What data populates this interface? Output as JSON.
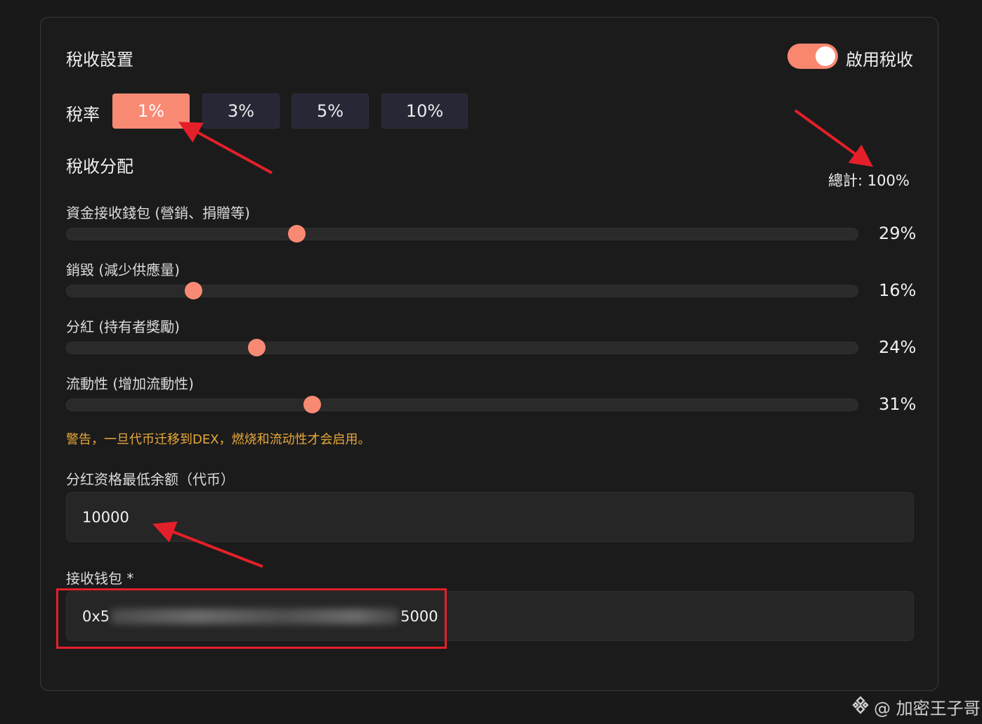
{
  "tax_settings": {
    "title": "稅收設置",
    "toggle_label": "啟用稅收",
    "toggle_on": true,
    "rate_label": "稅率",
    "rates": [
      "1%",
      "3%",
      "5%",
      "10%"
    ],
    "selected_rate": "1%"
  },
  "distribution": {
    "title": "稅收分配",
    "total": "總計: 100%",
    "items": [
      {
        "label": "資金接收錢包 (營銷、捐贈等)",
        "value": 29,
        "display": "29%"
      },
      {
        "label": "銷毀 (減少供應量)",
        "value": 16,
        "display": "16%"
      },
      {
        "label": "分紅 (持有者獎勵)",
        "value": 24,
        "display": "24%"
      },
      {
        "label": "流動性 (增加流動性)",
        "value": 31,
        "display": "31%"
      }
    ],
    "warning": "警告，一旦代币迁移到DEX，燃烧和流动性才会启用。"
  },
  "dividend": {
    "label": "分红资格最低余额（代币）",
    "value": "10000"
  },
  "wallet": {
    "label": "接收钱包 *",
    "value_prefix": "0x5",
    "value_suffix": "5000"
  },
  "watermark": {
    "text": "@ 加密王子哥"
  },
  "colors": {
    "accent": "#f98770",
    "warning": "#e7a83a",
    "annotation": "#e3202a"
  }
}
